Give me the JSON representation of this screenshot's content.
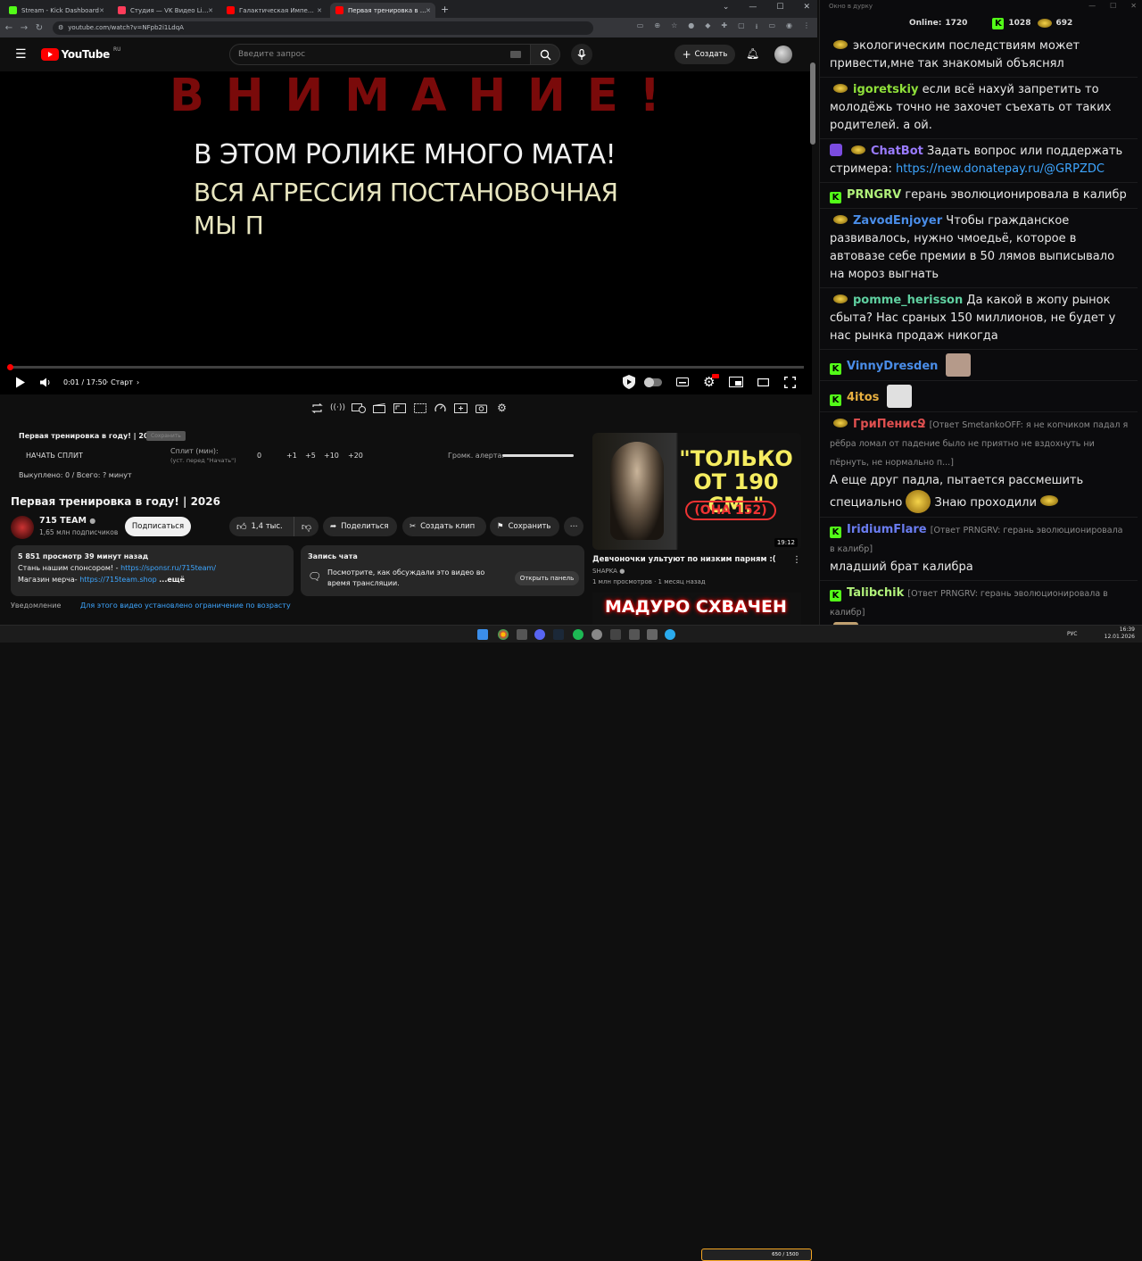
{
  "browser": {
    "tabs": [
      {
        "label": "Stream - Kick Dashboard",
        "color": "#53fc18"
      },
      {
        "label": "Студия — VK Видео Live",
        "color": "#ff3c5a"
      },
      {
        "label": "Галактическая Империя – все...",
        "color": "#ff0000"
      },
      {
        "label": "Первая тренировка в году! | 2...",
        "color": "#ff0000"
      }
    ],
    "url": "youtube.com/watch?v=NFpb2i1LdqA"
  },
  "youtube": {
    "logo_text": "YouTube",
    "logo_region": "RU",
    "search_placeholder": "Введите запрос",
    "create_label": "Создать"
  },
  "video": {
    "overlay_warning": "ВНИМАНИЕ!",
    "overlay_line1": "В ЭТОМ РОЛИКЕ  МНОГО МАТА!",
    "overlay_line2": "ВСЯ АГРЕССИЯ ПОСТАНОВОЧНАЯ",
    "overlay_line3": "МЫ П",
    "time": "0:01 / 17:50",
    "chapter": "· Старт",
    "progress": 0.001
  },
  "plugin": {
    "title": "Первая тренировка в году! | 2026",
    "title_badge": "Сохранить",
    "split_button": "НАЧАТЬ СПЛИТ",
    "split_label": "Сплит (мин):",
    "split_hint": "(уст. перед \"Начать\")",
    "split_value": "0",
    "increments": [
      "+1",
      "+5",
      "+10",
      "+20"
    ],
    "volume_label": "Громк. алерта:",
    "paid": "Выкуплено: 0 / Всего: ? минут"
  },
  "meta": {
    "title": "Первая тренировка в году! | 2026",
    "channel": "715 TEAM",
    "subscribers": "1,65 млн подписчиков",
    "subscribe_label": "Подписаться",
    "likes": "1,4 тыс.",
    "share": "Поделиться",
    "clip": "Создать клип",
    "save": "Сохранить"
  },
  "description": {
    "stats": "5 851 просмотр  39 минут назад",
    "line2_prefix": "Стань нашим спонсором! - ",
    "line2_link": "https://sponsr.ru/715team/",
    "line3_prefix": "Магазин мерча- ",
    "line3_link": "https://715team.shop",
    "more": "...ещё"
  },
  "chat_replay": {
    "title": "Запись чата",
    "text": "Посмотрите, как обсуждали это видео во время трансляции.",
    "button": "Открыть панель"
  },
  "notice": {
    "label": "Уведомление",
    "text": "Для этого видео установлено ограничение по возрасту"
  },
  "recommendations": [
    {
      "thumb_title": "\"ТОЛЬКО ОТ 190 СМ.\"",
      "thumb_sub": "(ОНА 152)",
      "duration": "19:12",
      "title": "Девчоночки ультуют по низким парням :(",
      "channel": "SHAPKA",
      "meta": "1 млн просмотров · 1 месяц назад"
    },
    {
      "thumb_title": "МАДУРО СХВАЧЕН"
    }
  ],
  "chat": {
    "window_title": "Окно в дурку",
    "online_label": "Online:",
    "online": "1720",
    "kick_count": "1028",
    "other_count": "692",
    "messages": [
      {
        "user": "",
        "text": "экологическим последствиям может привести,мне так знакомый объяснял",
        "color": "#e8e8e8",
        "badge": "none"
      },
      {
        "user": "igoretskiy",
        "text": "если всё нахуй запретить то молодёжь точно не захочет съехать от таких родителей. а ой.",
        "color": "#8fe03a",
        "badge": "e"
      },
      {
        "user": "ChatBot",
        "text": "Задать вопрос или поддержать стримера: ",
        "link": "https://new.donatepay.ru/@GRPZDC",
        "color": "#9a7bff",
        "badge": "pe"
      },
      {
        "user": "PRNGRV",
        "text": "герань эволюционировала в калибр",
        "color": "#b0f07a",
        "badge": "k"
      },
      {
        "user": "ZavodEnjoyer",
        "text": "Чтобы гражданское развивалось, нужно чмоедьё, которое в автовазе себе премии в 50 лямов выписывало на мороз выгнать",
        "color": "#4a8de8",
        "badge": "e"
      },
      {
        "user": "pomme_herisson",
        "text": "Да какой в жопу рынок сбыта? Нас сраных 150 миллионов, не будет у нас рынка продаж никогда",
        "color": "#5fd0a0",
        "badge": "e"
      },
      {
        "user": "VinnyDresden",
        "text": "",
        "color": "#4a8de8",
        "badge": "k",
        "emote": "#b59a8a"
      },
      {
        "user": "4itos",
        "text": "",
        "color": "#e8b040",
        "badge": "k",
        "emote": "#e0e0e0"
      },
      {
        "user": "ГриПенисՋ",
        "reply": "[Ответ SmetankoOFF: я не копчиком падал я рёбра ломал от падение было не приятно не вздохнуть ни пёрнуть, не нормально п...]",
        "text": "А еще друг падла, пытается рассмешить специально",
        "text2": "Знаю проходили",
        "color": "#e05050",
        "badge": "e"
      },
      {
        "user": "IridiumFlare",
        "reply": "[Ответ PRNGRV: герань эволюционировала в калибр]",
        "text": "младший брат калибра",
        "color": "#6a7cf0",
        "badge": "k"
      },
      {
        "user": "Talibchik",
        "reply": "[Ответ PRNGRV: герань эволюционировала в калибр]",
        "text": "",
        "color": "#b0f07a",
        "badge": "k",
        "emote": "#c0a070"
      }
    ]
  },
  "taskbar": {
    "lang": "РУС",
    "time": "16:39",
    "date": "12.01.2026",
    "progress_text": "650 / 1500"
  }
}
